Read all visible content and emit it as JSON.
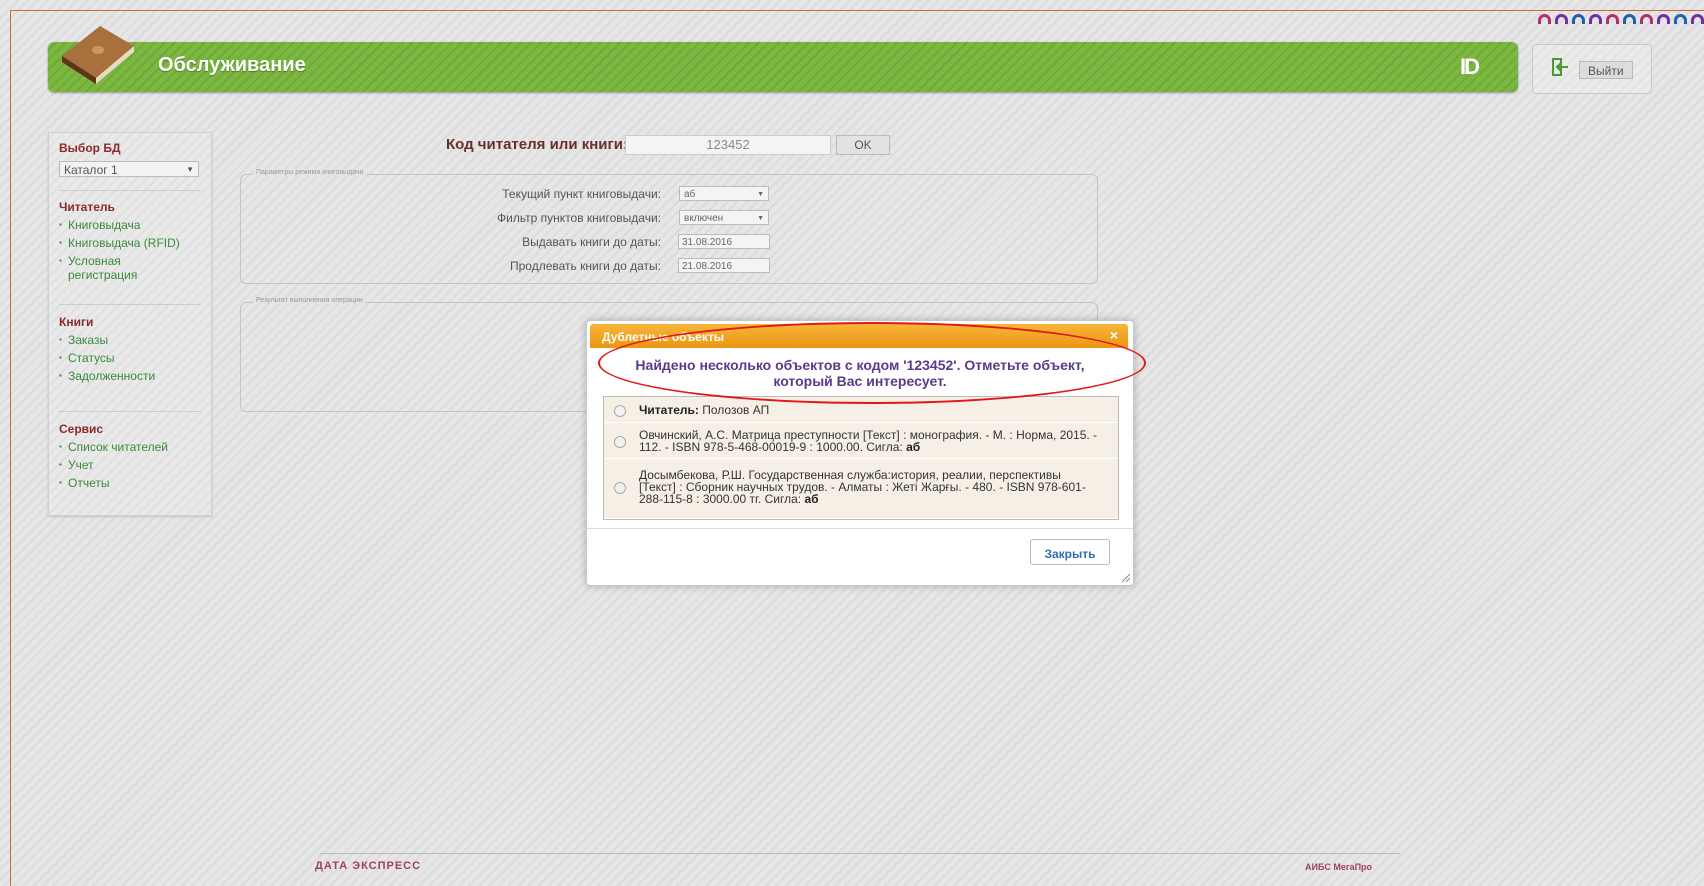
{
  "header": {
    "title": "Обслуживание",
    "mark": "ID",
    "exit_label": "Выйти"
  },
  "sidebar": {
    "db_heading": "Выбор БД",
    "db_selected": "Каталог 1",
    "reader_heading": "Читатель",
    "reader_items": [
      "Книговыдача",
      "Книговыдача (RFID)",
      "Условная регистрация"
    ],
    "books_heading": "Книги",
    "books_items": [
      "Заказы",
      "Статусы",
      "Задолженности"
    ],
    "service_heading": "Сервис",
    "service_items": [
      "Список читателей",
      "Учет",
      "Отчеты"
    ]
  },
  "main": {
    "code_label": "Код читателя или книги:",
    "code_value": "123452",
    "ok_label": "OK",
    "params_legend": "Параметры режима книговыдачи",
    "current_point_label": "Текущий пункт книговыдачи:",
    "current_point_value": "аб",
    "filter_label": "Фильтр пунктов книговыдачи:",
    "filter_value": "включен",
    "issue_until_label": "Выдавать книги до даты:",
    "issue_until_value": "31.08.2016",
    "extend_until_label": "Продлевать книги до даты:",
    "extend_until_value": "21.08.2016",
    "result_legend": "Результат выполнения операции"
  },
  "modal": {
    "title": "Дублетные объекты",
    "close_glyph": "×",
    "message_line1": "Найдено несколько объектов с кодом '123452'. Отметьте объект,",
    "message_line2": "который Вас интересует.",
    "options": [
      {
        "bold": "Читатель:",
        "text": " Полозов АП",
        "tail": ""
      },
      {
        "bold": "",
        "text": "Овчинский, А.С. Матрица преступности [Текст] : монография. - М. : Норма, 2015. - 112. - ISBN 978-5-468-00019-9 : 1000.00. Сигла: ",
        "tail": "аб"
      },
      {
        "bold": "",
        "text": "Досымбекова, Р.Ш. Государственная служба:история, реалии, перспективы [Текст] : Сборник научных трудов. - Алматы : Жеті Жарғы. - 480. - ISBN 978-601-288-115-8 : 3000.00 тг. Сигла: ",
        "tail": "аб"
      }
    ],
    "close_button": "Закрыть"
  },
  "footer": {
    "left_logo": "ДАТА ЭКСПРЕСС",
    "right_logo": "АИБС МегаПро"
  },
  "colors": {
    "header_green": "#7cb742",
    "modal_orange": "#f0a020",
    "heading_red": "#8a2a2a",
    "link_green": "#3a8a3a",
    "message_purple": "#5b3a8a",
    "highlight_red": "#e01818"
  }
}
